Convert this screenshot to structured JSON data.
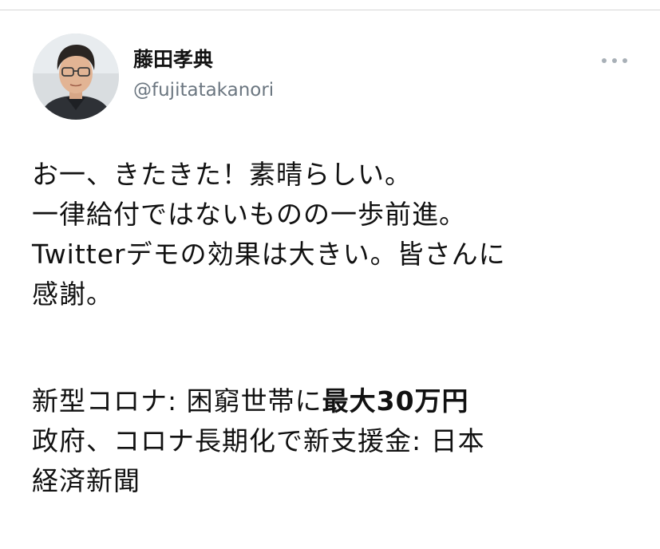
{
  "tweet": {
    "author": {
      "display_name": "藤田孝典",
      "handle": "@fujitatakanori"
    },
    "more_icon": "more-horizontal-icon",
    "text_lines": [
      "お一、きたきた！素晴らしい。",
      "一律給付ではないものの一歩前進。",
      "Twitterデモの効果は大きい。皆さんに",
      "感謝。"
    ],
    "link_card": {
      "headline_prefix": "新型コロナ: 困窮世帯に",
      "headline_bold": "最大30万円",
      "headline_lines": [
        "政府、コロナ長期化で新支援金: 日本",
        "経済新聞"
      ]
    }
  },
  "colors": {
    "text": "#111111",
    "handle": "#6b7680",
    "more_dots": "#a8b0b7"
  }
}
